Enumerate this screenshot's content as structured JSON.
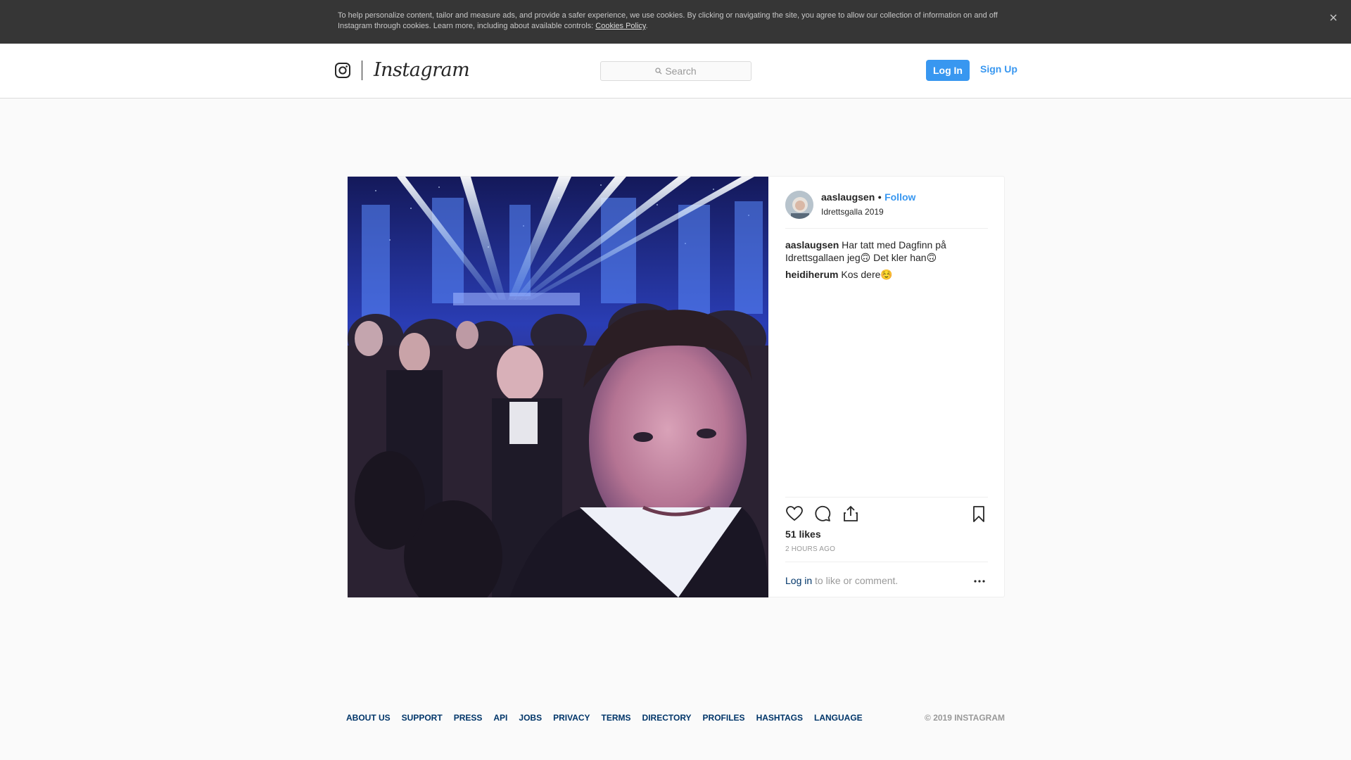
{
  "cookie_banner": {
    "text": "To help personalize content, tailor and measure ads, and provide a safer experience, we use cookies. By clicking or navigating the site, you agree to allow our collection of information on and off Instagram through cookies. Learn more, including about available controls: ",
    "link_text": "Cookies Policy",
    "suffix": ".",
    "close_icon": "close-icon"
  },
  "header": {
    "logo_icon": "instagram-glyph-icon",
    "wordmark": "Instagram",
    "search": {
      "placeholder": "Search",
      "icon": "search-icon"
    },
    "login_label": "Log In",
    "signup_label": "Sign Up",
    "accent_color": "#3897f0"
  },
  "post": {
    "author": "aaslaugsen",
    "separator": "•",
    "follow_label": "Follow",
    "location": "Idrettsgalla 2019",
    "comments": [
      {
        "user": "aaslaugsen",
        "text": "Har tatt med Dagfinn på Idrettsgallaen jeg🙃  Det kler han🙃"
      },
      {
        "user": "heidiherum",
        "text": "Kos dere☺️"
      }
    ],
    "likes": "51 likes",
    "time_ago": "2 HOURS AGO",
    "login_prompt": {
      "link": "Log in",
      "text": " to like or comment."
    },
    "icons": [
      "heart-icon",
      "comment-icon",
      "share-icon",
      "bookmark-icon",
      "more-icon"
    ]
  },
  "footer": {
    "links": [
      "About Us",
      "Support",
      "Press",
      "API",
      "Jobs",
      "Privacy",
      "Terms",
      "Directory",
      "Profiles",
      "Hashtags",
      "Language"
    ],
    "copyright": "© 2019 Instagram"
  }
}
